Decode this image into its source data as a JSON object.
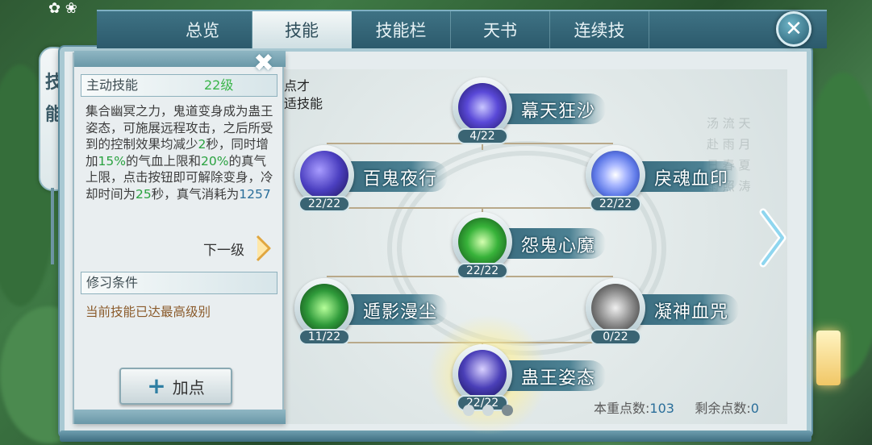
{
  "tabs": [
    {
      "label": "总览"
    },
    {
      "label": "技能",
      "active": true
    },
    {
      "label": "技能栏"
    },
    {
      "label": "天书"
    },
    {
      "label": "连续技"
    }
  ],
  "close_label": "✕",
  "side_tab": {
    "chars": [
      "技",
      "能"
    ]
  },
  "info_panel": {
    "section_title": "主动技能",
    "level_text": "22级",
    "description_parts": [
      {
        "t": "集合幽冥之力，鬼道变身成为蛊王姿态，可施展远程攻击，之后所受到的控制效果均减少",
        "c": "n"
      },
      {
        "t": "2",
        "c": "h"
      },
      {
        "t": "秒，同时增加",
        "c": "n"
      },
      {
        "t": "15%",
        "c": "h"
      },
      {
        "t": "的气血上限和",
        "c": "n"
      },
      {
        "t": "20%",
        "c": "h"
      },
      {
        "t": "的真气上限，点击按钮即可解除变身，冷却时间为",
        "c": "n"
      },
      {
        "t": "25",
        "c": "h"
      },
      {
        "t": "秒，真气消耗为",
        "c": "n"
      },
      {
        "t": "1257",
        "c": "b"
      }
    ],
    "next_level_label": "下一级",
    "conditions_title": "修习条件",
    "conditions_text": "当前技能已达最高级别",
    "add_button_label": "加点",
    "close_label": "✖"
  },
  "partial_text": [
    "点才",
    "适技能"
  ],
  "skills": [
    {
      "name": "幕天狂沙",
      "level": "4/22",
      "color": "#5a49d8"
    },
    {
      "name": "百鬼夜行",
      "level": "22/22",
      "color": "#4b3fc0"
    },
    {
      "name": "戾魂血印",
      "level": "22/22",
      "color": "#5f7ae8"
    },
    {
      "name": "怨鬼心魔",
      "level": "22/22",
      "color": "#38b33a"
    },
    {
      "name": "遁影漫尘",
      "level": "11/22",
      "color": "#2f9a3a"
    },
    {
      "name": "凝神血咒",
      "level": "0/22",
      "color": "#8a8a8a"
    },
    {
      "name": "蛊王姿态",
      "level": "22/22",
      "color": "#4a3fb8"
    }
  ],
  "points": {
    "spent_label": "本重点数:",
    "spent_value": "103",
    "remaining_label": "剩余点数:",
    "remaining_value": "0"
  },
  "poem": "汤 流 天 赴 雨 月 日 春 夏 雨 照 涛"
}
